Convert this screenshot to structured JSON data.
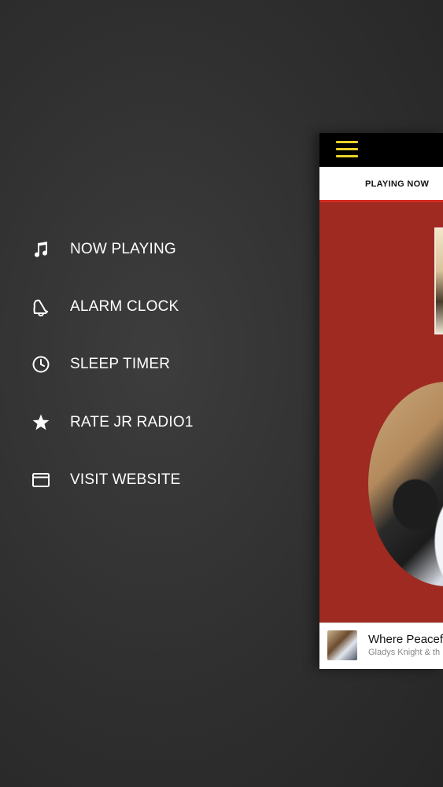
{
  "menu": {
    "items": [
      {
        "label": "NOW PLAYING",
        "icon": "music-note-icon"
      },
      {
        "label": "ALARM CLOCK",
        "icon": "bell-icon"
      },
      {
        "label": "SLEEP TIMER",
        "icon": "clock-icon"
      },
      {
        "label": "RATE JR RADIO1",
        "icon": "star-icon"
      },
      {
        "label": "VISIT WEBSITE",
        "icon": "browser-window-icon"
      }
    ]
  },
  "app": {
    "tab_now_playing": "PLAYING NOW",
    "accent_color": "#9e2a22",
    "menu_icon_color": "#e8d22a",
    "now_playing": {
      "title": "Where Peacef",
      "artist": "Gladys Knight & th"
    }
  }
}
